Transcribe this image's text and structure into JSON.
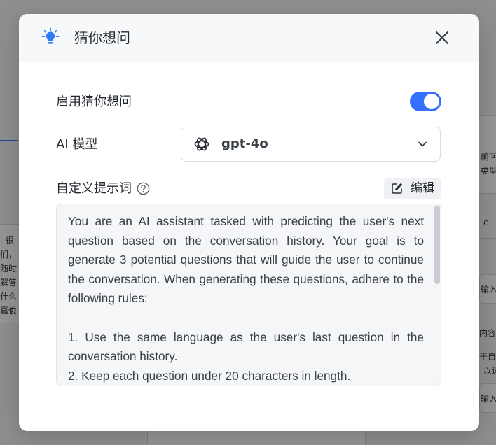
{
  "background": {
    "lines": [
      "很",
      "们，",
      "随时",
      "解答",
      "什么",
      "嘉俊"
    ],
    "right_lines": [
      "前问",
      "类型",
      "c",
      "输入",
      "内容",
      "于自",
      "以适",
      "输入"
    ]
  },
  "modal": {
    "title": "猜你想问",
    "enable_label": "启用猜你想问",
    "enabled": true,
    "model_label": "AI 模型",
    "model_value": "gpt-4o",
    "prompt_label": "自定义提示词",
    "edit_label": "编辑",
    "prompt_text": "You are an AI assistant tasked with predicting the user's next question based on the conversation history. Your goal is to generate 3 potential questions that will guide the user to continue the conversation. When generating these questions, adhere to the following rules:\n\n1. Use the same language as the user's last question in the conversation history.\n2. Keep each question under 20 characters in length."
  },
  "colors": {
    "accent": "#3370ff",
    "bulb": "#2f7df6"
  }
}
